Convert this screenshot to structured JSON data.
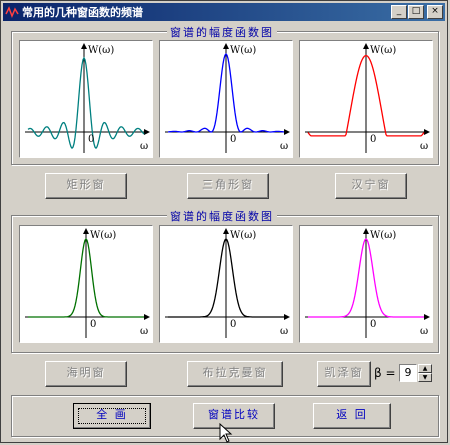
{
  "window": {
    "title": "常用的几种窗函数的频谱",
    "minimize": "_",
    "maximize": "□",
    "close": "×"
  },
  "groups": [
    {
      "label": "窗谱的幅度函数图",
      "plots": [
        {
          "name": "rectangular",
          "color": "#008080",
          "ylabel": "W(ω)",
          "origin": "0",
          "xlabel": "ω"
        },
        {
          "name": "triangular",
          "color": "#0000ff",
          "ylabel": "W(ω)",
          "origin": "0",
          "xlabel": "ω"
        },
        {
          "name": "hanning",
          "color": "#ff0000",
          "ylabel": "W(ω)",
          "origin": "0",
          "xlabel": "ω"
        }
      ],
      "buttons": [
        "矩形窗",
        "三角形窗",
        "汉宁窗"
      ]
    },
    {
      "label": "窗谱的幅度函数图",
      "plots": [
        {
          "name": "hamming",
          "color": "#007000",
          "ylabel": "W(ω)",
          "origin": "0",
          "xlabel": "ω"
        },
        {
          "name": "blackman",
          "color": "#000000",
          "ylabel": "W(ω)",
          "origin": "0",
          "xlabel": "ω"
        },
        {
          "name": "kaiser",
          "color": "#ff00ff",
          "ylabel": "W(ω)",
          "origin": "0",
          "xlabel": "ω"
        }
      ],
      "buttons": [
        "海明窗",
        "布拉克曼窗",
        "凯泽窗"
      ]
    }
  ],
  "beta": {
    "label": "β =",
    "value": "9"
  },
  "actions": {
    "full": "全 画",
    "compare": "窗谱比较",
    "back": "返 回"
  },
  "spinner": {
    "up": "▲",
    "down": "▼"
  }
}
